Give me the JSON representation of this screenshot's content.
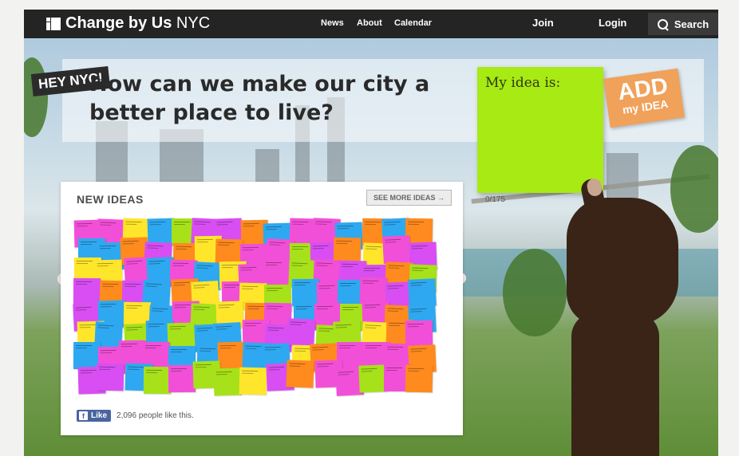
{
  "navbar": {
    "logo_text": "Change by Us",
    "logo_city": "NYC",
    "links": [
      "News",
      "About",
      "Calendar"
    ],
    "join": "Join",
    "login": "Login",
    "search": "Search"
  },
  "hero": {
    "badge": "HEY NYC!",
    "headline": "How can we make our city a better place to live?"
  },
  "idea_form": {
    "sticky_label": "My idea is:",
    "char_counter": "0/175",
    "add_big": "ADD",
    "add_small": "my IDEA",
    "sticky_color": "#a8ea14",
    "add_color": "#f0a15a"
  },
  "ideas_panel": {
    "title": "NEW IDEAS",
    "see_more": "SEE MORE IDEAS →",
    "note_colors": [
      "#f24fd8",
      "#ffe62b",
      "#2ea8f0",
      "#a7e11a",
      "#ff8a1e",
      "#d84ef2"
    ]
  },
  "facebook": {
    "like_label": "Like",
    "count_text": "2,096 people like this."
  }
}
